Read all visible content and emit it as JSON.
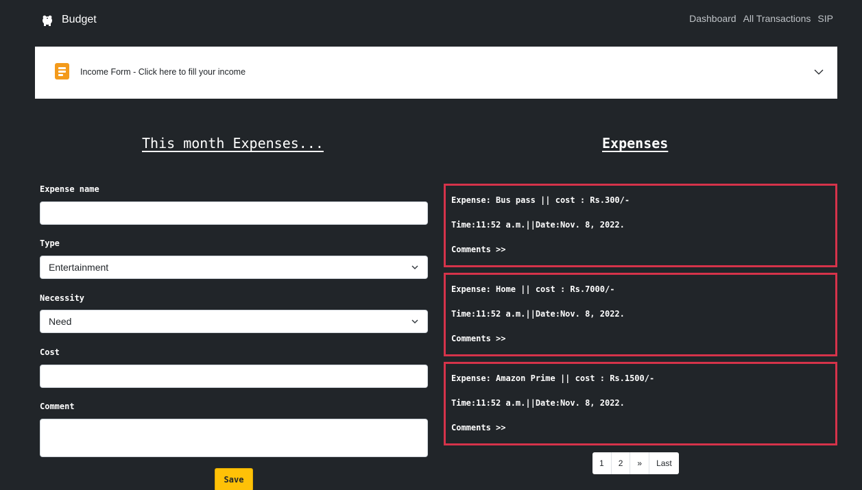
{
  "navbar": {
    "brand": "Budget",
    "brand_icon": "piggy-bank-icon",
    "links": [
      "Dashboard",
      "All Transactions",
      "SIP"
    ]
  },
  "income_accordion": {
    "icon": "form-document-icon",
    "title": "Income Form - Click here to fill your income",
    "icon_color": "#f39a1b"
  },
  "form": {
    "heading": "This month Expenses...",
    "expense_name_label": "Expense name",
    "expense_name_value": "",
    "type_label": "Type",
    "type_value": "Entertainment",
    "necessity_label": "Necessity",
    "necessity_value": "Need",
    "cost_label": "Cost",
    "cost_value": "",
    "comment_label": "Comment",
    "comment_value": "",
    "save_label": "Save"
  },
  "expenses": {
    "heading": "Expenses",
    "items": [
      {
        "expense": "Expense: Bus pass || cost : Rs.300/-",
        "time": "Time:11:52 a.m.||Date:Nov. 8, 2022.",
        "comments": "Comments >>"
      },
      {
        "expense": "Expense: Home || cost : Rs.7000/-",
        "time": "Time:11:52 a.m.||Date:Nov. 8, 2022.",
        "comments": "Comments >>"
      },
      {
        "expense": "Expense: Amazon Prime || cost : Rs.1500/-",
        "time": "Time:11:52 a.m.||Date:Nov. 8, 2022.",
        "comments": "Comments >>"
      }
    ],
    "card_border_color": "#d6334a"
  },
  "pagination": {
    "pages": [
      "1",
      "2"
    ],
    "next": "»",
    "last": "Last"
  },
  "colors": {
    "background": "#212529",
    "save_button": "#ffc107"
  }
}
